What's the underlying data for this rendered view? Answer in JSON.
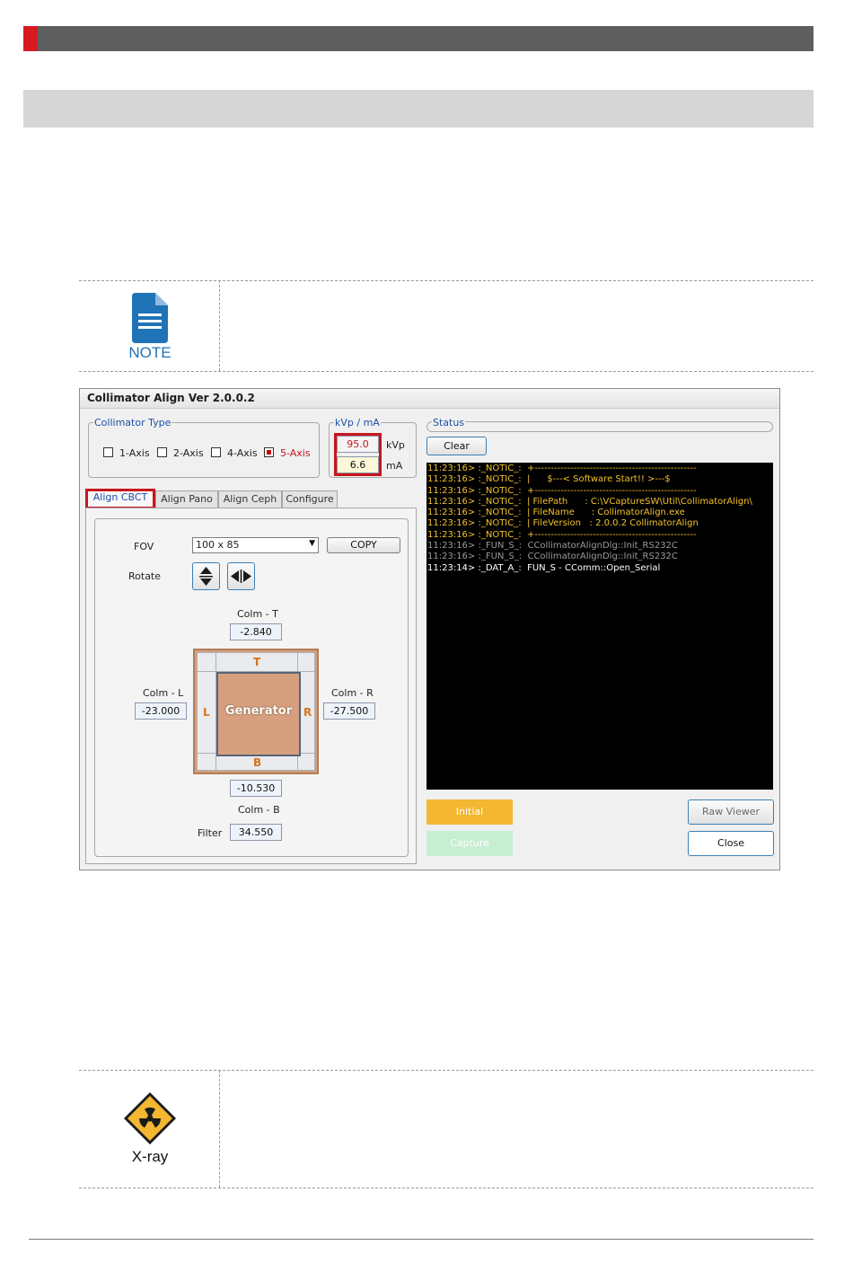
{
  "note": {
    "label": "NOTE"
  },
  "xray": {
    "label": "X-ray"
  },
  "app": {
    "title": "Collimator Align  Ver 2.0.0.2",
    "collimator_type": {
      "legend": "Collimator Type",
      "options": [
        {
          "label": "1-Axis",
          "checked": false
        },
        {
          "label": "2-Axis",
          "checked": false
        },
        {
          "label": "4-Axis",
          "checked": false
        },
        {
          "label": "5-Axis",
          "checked": true
        }
      ]
    },
    "kvp_ma": {
      "legend": "kVp / mA",
      "kvp_value": "95.0",
      "kvp_unit": "kVp",
      "ma_value": "6.6",
      "ma_unit": "mA"
    },
    "tabs": [
      "Align CBCT",
      "Align Pano",
      "Align Ceph",
      "Configure"
    ],
    "cbct": {
      "fov_label": "FOV",
      "fov_value": "100 x 85",
      "copy_label": "COPY",
      "rotate_label": "Rotate",
      "colm_t_label": "Colm - T",
      "colm_t_value": "-2.840",
      "colm_l_label": "Colm - L",
      "colm_l_value": "-23.000",
      "colm_r_label": "Colm - R",
      "colm_r_value": "-27.500",
      "colm_b_label": "Colm - B",
      "colm_b_value": "-10.530",
      "filter_label": "Filter",
      "filter_value": "34.550",
      "generator_label": "Generator",
      "side_t": "T",
      "side_b": "B",
      "side_l": "L",
      "side_r": "R"
    },
    "status": {
      "legend": "Status",
      "clear_label": "Clear",
      "log": [
        {
          "text": "11:23:16> :_NOTIC_:  +--------------------------------------------------",
          "color": "#f3c22b"
        },
        {
          "text": "11:23:16> :_NOTIC_:  |      $---< Software Start!! >---$",
          "color": "#f3c22b"
        },
        {
          "text": "11:23:16> :_NOTIC_:  +--------------------------------------------------",
          "color": "#f3c22b"
        },
        {
          "text": "11:23:16> :_NOTIC_:  | FilePath      : C:\\VCaptureSW\\Util\\CollimatorAlign\\",
          "color": "#f3c22b"
        },
        {
          "text": "11:23:16> :_NOTIC_:  | FileName      : CollimatorAlign.exe",
          "color": "#f3c22b"
        },
        {
          "text": "11:23:16> :_NOTIC_:  | FileVersion   : 2.0.0.2 CollimatorAlign",
          "color": "#f3c22b"
        },
        {
          "text": "11:23:16> :_NOTIC_:  +--------------------------------------------------",
          "color": "#f3c22b"
        },
        {
          "text": "11:23:16> :_FUN_S_:  CCollimatorAlignDlg::Init_RS232C",
          "color": "#9a9a9a"
        },
        {
          "text": "11:23:16> :_FUN_S_:  CCollimatorAlignDlg::Init_RS232C",
          "color": "#9a9a9a"
        },
        {
          "text": "11:23:14> :_DAT_A_:  FUN_S - CComm::Open_Serial",
          "color": "#ffffff"
        }
      ],
      "initial_label": "Initial",
      "capture_label": "Capture",
      "raw_viewer_label": "Raw Viewer",
      "close_label": "Close"
    }
  }
}
